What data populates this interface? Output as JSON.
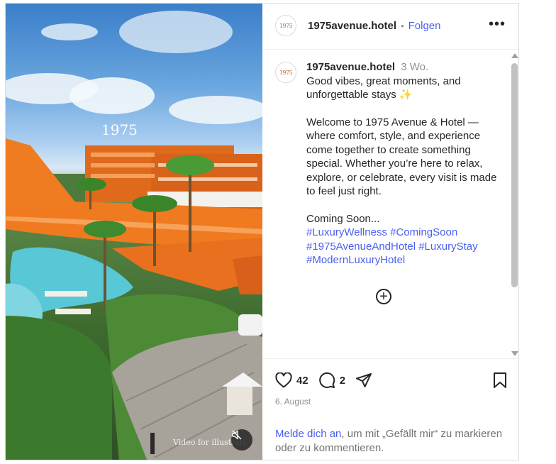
{
  "post": {
    "media": {
      "sign_text": "1975",
      "overlay_caption": "Video for illustrati",
      "mute_icon": "speaker-muted-icon"
    },
    "header": {
      "avatar_text": "1975",
      "username": "1975avenue.hotel",
      "separator": "•",
      "follow_label": "Folgen",
      "more_icon": "more-options-icon",
      "more_label": "•••"
    },
    "caption": {
      "avatar_text": "1975",
      "username": "1975avenue.hotel",
      "time_ago": "3 Wo.",
      "line1": "Good vibes, great moments, and unforgettable stays ✨",
      "line2": "Welcome to 1975 Avenue & Hotel — where comfort, style, and experience come together to create something special. Whether you’re here to relax, explore, or celebrate, every visit is made to feel just right.",
      "line3": "Coming Soon...",
      "hashtags": [
        "#LuxuryWellness",
        "#ComingSoon",
        "#1975AvenueAndHotel",
        "#LuxuryStay",
        "#ModernLuxuryHotel"
      ],
      "load_more_label": "+"
    },
    "actions": {
      "likes": "42",
      "comments": "2",
      "date": "6. August",
      "login_link": "Melde dich an",
      "login_rest": ", um mit „Gefällt mir“ zu markieren oder zu kommentieren."
    },
    "colors": {
      "accent": "#4a5ef0",
      "text": "#262626",
      "muted": "#8e8e8e",
      "hotel_orange": "#e8701e"
    }
  }
}
